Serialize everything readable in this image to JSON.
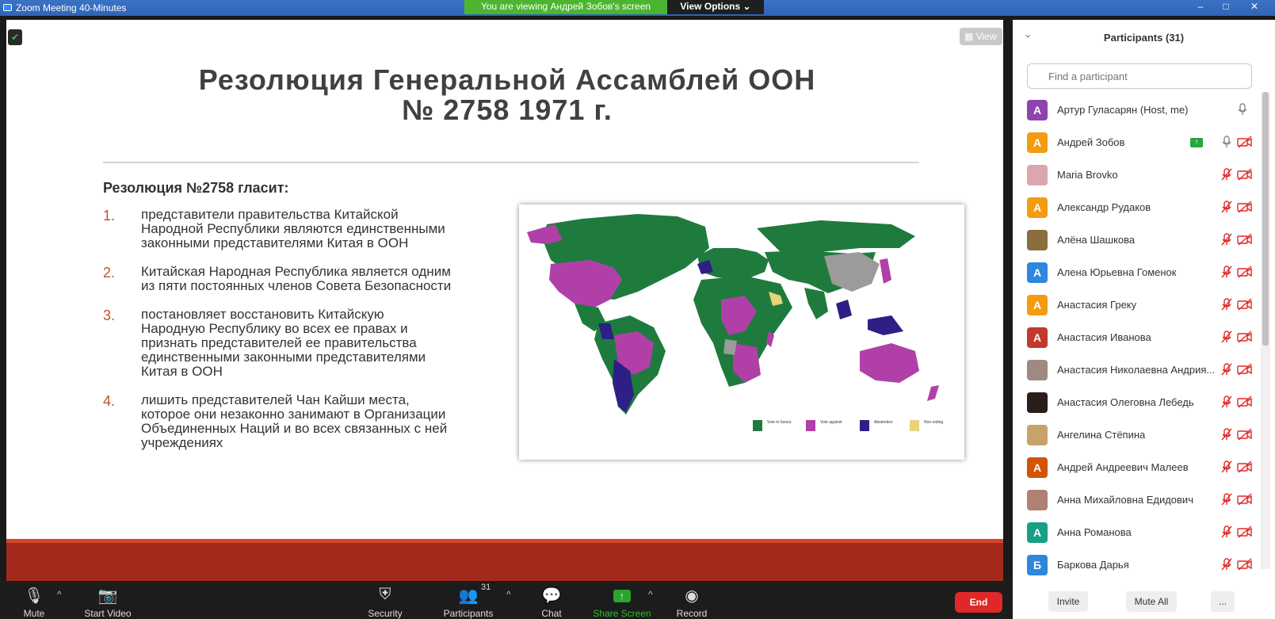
{
  "window": {
    "title": "Zoom Meeting 40-Minutes",
    "banner": "You are viewing Андрей Зобов's screen",
    "view_options": "View Options",
    "minimize": "–",
    "maximize": "□",
    "close": "✕"
  },
  "share": {
    "view_label": "View",
    "slide": {
      "title_line1": "Резолюция Генеральной Ассамблей ООН",
      "title_line2": "№ 2758  1971 г.",
      "heading": "Резолюция №2758 гласит:",
      "points": [
        {
          "num": "1.",
          "text": "представители правительства Китайской Народной Республики являются единственными законными представителями Китая в ООН"
        },
        {
          "num": "2.",
          "text": "Китайская Народная Республика является одним из пяти постоянных членов Совета Безопасности"
        },
        {
          "num": "3.",
          "text": "постановляет восстановить Китайскую Народную Республику во всех ее правах и признать представителей ее правительства единственными законными представителями Китая в ООН"
        },
        {
          "num": "4.",
          "text": "лишить представителей Чан Кайши места, которое они незаконно занимают в Организации Объединенных Наций и во всех связанных с ней учреждениях"
        }
      ],
      "legend": [
        {
          "count": "76",
          "line1": "Vote in favour",
          "line2": "Voto a favor",
          "line3": "赞成",
          "color": "#1e7b3d"
        },
        {
          "count": "35",
          "line1": "Vote against",
          "line2": "Voto en contra",
          "line3": "反对",
          "color": "#b040a8"
        },
        {
          "count": "17",
          "line1": "Abstention",
          "line2": "Abstención",
          "line3": "弃权",
          "color": "#2d1f86"
        },
        {
          "count": "3",
          "line1": "Non-voting",
          "line2": "No votante",
          "line3": "缺席",
          "color": "#e8d27a"
        }
      ]
    }
  },
  "toolbar": {
    "mute": "Mute",
    "start_video": "Start Video",
    "security": "Security",
    "participants": "Participants",
    "participants_count": "31",
    "chat": "Chat",
    "share_screen": "Share Screen",
    "record": "Record",
    "end": "End"
  },
  "panel": {
    "title": "Participants (31)",
    "search_placeholder": "Find a participant",
    "participants": [
      {
        "initial": "А",
        "name": "Артур Гуласарян (Host, me)",
        "color": "#8e44ad"
      },
      {
        "initial": "А",
        "name": "Андрей Зобов",
        "color": "#f39c12"
      },
      {
        "initial": "",
        "name": "Maria Brovko",
        "color": "#dba6b0"
      },
      {
        "initial": "А",
        "name": "Александр Рудаков",
        "color": "#f39c12"
      },
      {
        "initial": "",
        "name": "Алёна Шашкова",
        "color": "#8a6e3e"
      },
      {
        "initial": "А",
        "name": "Алена Юрьевна Гоменок",
        "color": "#2e86de"
      },
      {
        "initial": "А",
        "name": "Анастасия Греку",
        "color": "#f39c12"
      },
      {
        "initial": "А",
        "name": "Анастасия Иванова",
        "color": "#c0392b"
      },
      {
        "initial": "",
        "name": "Анастасия Николаевна Андрия...",
        "color": "#9e8a80"
      },
      {
        "initial": "",
        "name": "Анастасия Олеговна Лебедь",
        "color": "#2a1d1a"
      },
      {
        "initial": "",
        "name": "Ангелина Стёпина",
        "color": "#c9a26b"
      },
      {
        "initial": "А",
        "name": "Андрей Андреевич Малеев",
        "color": "#d35400"
      },
      {
        "initial": "",
        "name": "Анна Михайловна Едидович",
        "color": "#b08070"
      },
      {
        "initial": "А",
        "name": "Анна Романова",
        "color": "#16a085"
      },
      {
        "initial": "Б",
        "name": "Баркова Дарья",
        "color": "#2e86de"
      }
    ],
    "invite": "Invite",
    "mute_all": "Mute All",
    "more": "..."
  }
}
